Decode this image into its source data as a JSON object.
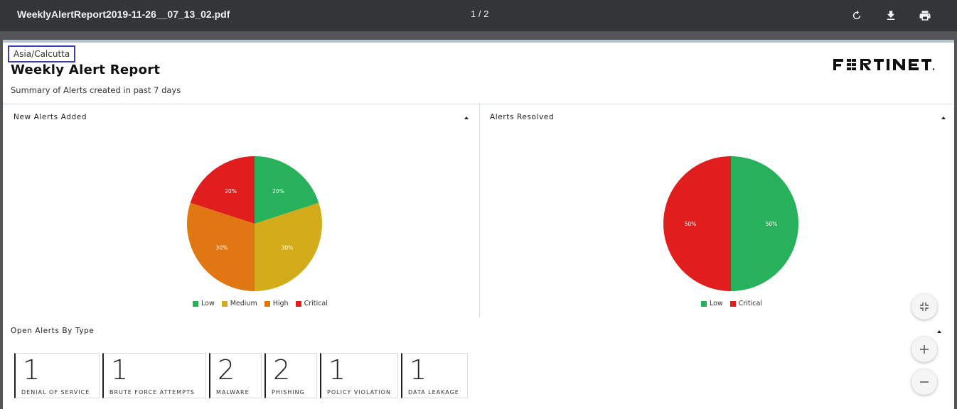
{
  "viewer": {
    "filename": "WeeklyAlertReport2019-11-26__07_13_02.pdf",
    "page_indicator": "1 / 2",
    "buttons": [
      "rotate-icon",
      "download-icon",
      "print-icon"
    ]
  },
  "report": {
    "timezone": "Asia/Calcutta",
    "title": "Weekly Alert Report",
    "subtitle": "Summary of Alerts created in past 7 days",
    "logo_text": "FORTINET"
  },
  "colors": {
    "low": "#27b15a",
    "medium": "#d2ac1b",
    "high": "#e17713",
    "critical": "#e01e1e"
  },
  "panels": {
    "new_alerts": {
      "title": "New Alerts Added"
    },
    "resolved": {
      "title": "Alerts Resolved"
    },
    "open_by_type": {
      "title": "Open Alerts By Type"
    }
  },
  "chart_data": [
    {
      "type": "pie",
      "title": "New Alerts Added",
      "categories": [
        "Low",
        "Medium",
        "High",
        "Critical"
      ],
      "values": [
        20,
        30,
        30,
        20
      ],
      "labels": [
        "20%",
        "30%",
        "30%",
        "20%"
      ],
      "legend": "bottom"
    },
    {
      "type": "pie",
      "title": "Alerts Resolved",
      "categories": [
        "Low",
        "Critical"
      ],
      "values": [
        50,
        50
      ],
      "labels": [
        "50%",
        "50%"
      ],
      "legend": "bottom"
    }
  ],
  "open_alerts": [
    {
      "count": "1",
      "label": "DENIAL OF SERVICE"
    },
    {
      "count": "1",
      "label": "BRUTE FORCE ATTEMPTS"
    },
    {
      "count": "2",
      "label": "MALWARE"
    },
    {
      "count": "2",
      "label": "PHISHING"
    },
    {
      "count": "1",
      "label": "POLICY VIOLATION"
    },
    {
      "count": "1",
      "label": "DATA LEAKAGE"
    }
  ],
  "zoom_controls": [
    "fit-page-icon",
    "zoom-in-icon",
    "zoom-out-icon"
  ]
}
